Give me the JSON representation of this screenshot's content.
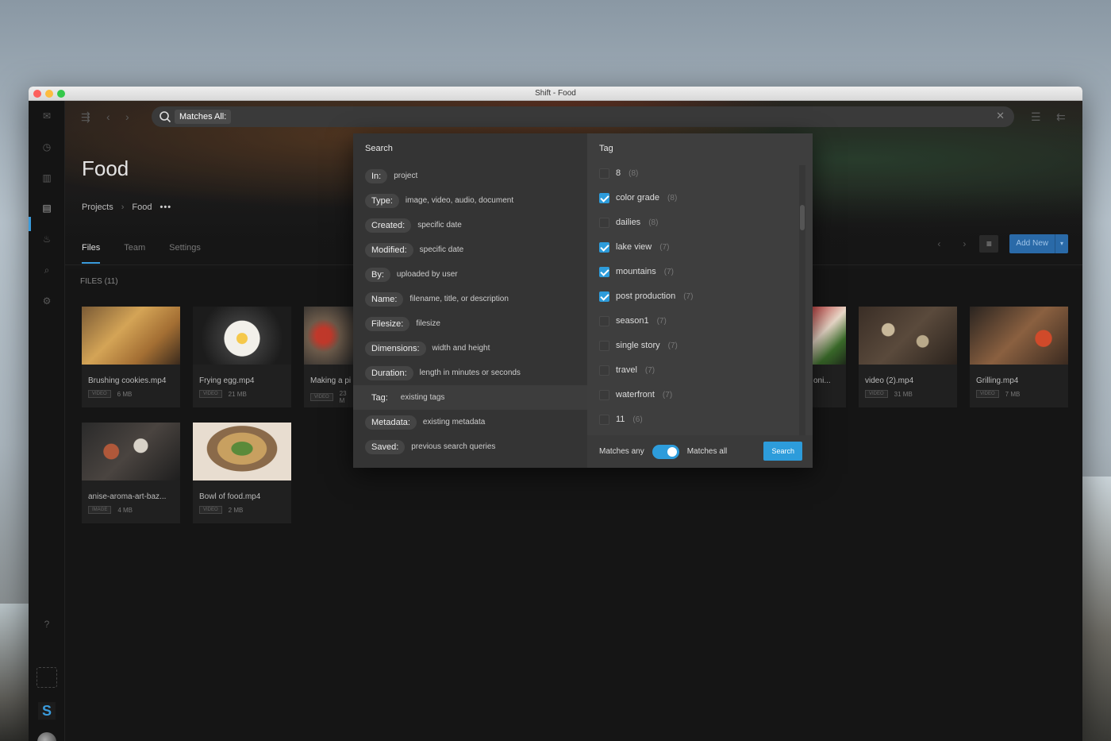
{
  "window": {
    "title": "Shift - Food"
  },
  "search": {
    "chip": "Matches All:"
  },
  "page": {
    "title": "Food"
  },
  "breadcrumb": {
    "projects": "Projects",
    "sep": "›",
    "current": "Food",
    "more": "•••"
  },
  "tabs": [
    {
      "label": "Files"
    },
    {
      "label": "Team"
    },
    {
      "label": "Settings"
    }
  ],
  "toolbar": {
    "add_new": "Add New",
    "add_new_caret": "▾",
    "prev": "‹",
    "next": "›",
    "filter": "≡"
  },
  "files": {
    "label": "FILES (11)"
  },
  "cards": [
    {
      "name": "Brushing cookies.mp4",
      "type": "VIDEO",
      "size": "6 MB"
    },
    {
      "name": "Frying egg.mp4",
      "type": "VIDEO",
      "size": "21 MB"
    },
    {
      "name": "Making a pi",
      "type": "VIDEO",
      "size": "23 M"
    },
    {
      "name": "l oni...",
      "type": "",
      "size": ""
    },
    {
      "name": "video (2).mp4",
      "type": "VIDEO",
      "size": "31 MB"
    },
    {
      "name": "Grilling.mp4",
      "type": "VIDEO",
      "size": "7 MB"
    },
    {
      "name": "anise-aroma-art-baz...",
      "type": "IMAGE",
      "size": "4 MB"
    },
    {
      "name": "Bowl of food.mp4",
      "type": "VIDEO",
      "size": "2 MB"
    }
  ],
  "dropdown": {
    "search_heading": "Search",
    "tag_heading": "Tag",
    "queries": [
      {
        "key": "In:",
        "value": "project"
      },
      {
        "key": "Type:",
        "value": "image, video, audio, document"
      },
      {
        "key": "Created:",
        "value": "specific date"
      },
      {
        "key": "Modified:",
        "value": "specific date"
      },
      {
        "key": "By:",
        "value": "uploaded by user"
      },
      {
        "key": "Name:",
        "value": "filename, title, or description"
      },
      {
        "key": "Filesize:",
        "value": "filesize"
      },
      {
        "key": "Dimensions:",
        "value": "width and height"
      },
      {
        "key": "Duration:",
        "value": "length in minutes or seconds"
      },
      {
        "key": "Tag:",
        "value": "existing tags"
      },
      {
        "key": "Metadata:",
        "value": "existing metadata"
      },
      {
        "key": "Saved:",
        "value": "previous search queries"
      }
    ],
    "tags": [
      {
        "name": "8",
        "count": "(8)",
        "checked": false
      },
      {
        "name": "color grade",
        "count": "(8)",
        "checked": true
      },
      {
        "name": "dailies",
        "count": "(8)",
        "checked": false
      },
      {
        "name": "lake view",
        "count": "(7)",
        "checked": true
      },
      {
        "name": "mountains",
        "count": "(7)",
        "checked": true
      },
      {
        "name": "post production",
        "count": "(7)",
        "checked": true
      },
      {
        "name": "season1",
        "count": "(7)",
        "checked": false
      },
      {
        "name": "single story",
        "count": "(7)",
        "checked": false
      },
      {
        "name": "travel",
        "count": "(7)",
        "checked": false
      },
      {
        "name": "waterfront",
        "count": "(7)",
        "checked": false
      },
      {
        "name": "11",
        "count": "(6)",
        "checked": false
      }
    ],
    "footer": {
      "matches_any": "Matches any",
      "matches_all": "Matches all",
      "search_button": "Search"
    }
  },
  "colors": {
    "accent": "#2d9cdb",
    "window_bg": "#151515"
  }
}
